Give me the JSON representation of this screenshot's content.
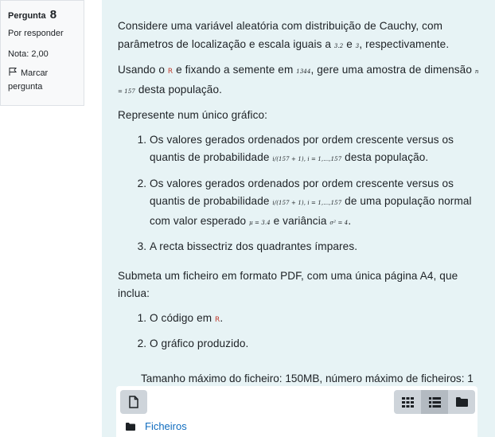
{
  "info": {
    "question_label": "Pergunta",
    "question_number": "8",
    "state": "Por responder",
    "grade": "Nota: 2,00",
    "flag_label": "Marcar pergunta"
  },
  "question": {
    "p1_a": "Considere uma variável aleatória com distribuição de Cauchy, com parâmetros de localização e escala iguais a ",
    "p1_loc": "3.2",
    "p1_b": " e ",
    "p1_scale": "3",
    "p1_c": ", respectivamente.",
    "p2_a": "Usando o ",
    "r_label": "R",
    "p2_b": " e fixando a semente em ",
    "p2_seed": "1344",
    "p2_c": ", gere uma amostra de dimensão ",
    "p2_n": "n = 157",
    "p2_d": " desta população.",
    "p3": "Represente num único gráfico:",
    "item1_a": "Os valores gerados ordenados por ordem crescente versus os quantis de probabilidade ",
    "item1_m": "i/(157 + 1),  i = 1,…,157",
    "item1_b": " desta população.",
    "item2_a": "Os valores gerados ordenados por ordem crescente versus os quantis de probabilidade ",
    "item2_m": "i/(157 + 1),  i = 1,…,157",
    "item2_b": " de uma população normal com valor esperado ",
    "item2_mu": "μ = 3.4",
    "item2_c": " e variância ",
    "item2_sigma": "σ² = 4",
    "item2_d": ".",
    "item3": "A recta bissectriz dos quadrantes ímpares.",
    "p4": "Submeta um ficheiro em formato PDF, com uma única página A4, que inclua:",
    "sub1_a": "O código em ",
    "sub1_b": ".",
    "sub2": "O gráfico produzido."
  },
  "limits_text": "Tamanho máximo do ficheiro: 150MB, número máximo de ficheiros: 1",
  "filepicker": {
    "folder_label": "Ficheiros",
    "active_view": "list"
  },
  "colors": {
    "content_bg": "#e7f3f5",
    "link": "#0f6cbf",
    "r_logo": "#c0392b",
    "button_bg": "#ced4da"
  }
}
